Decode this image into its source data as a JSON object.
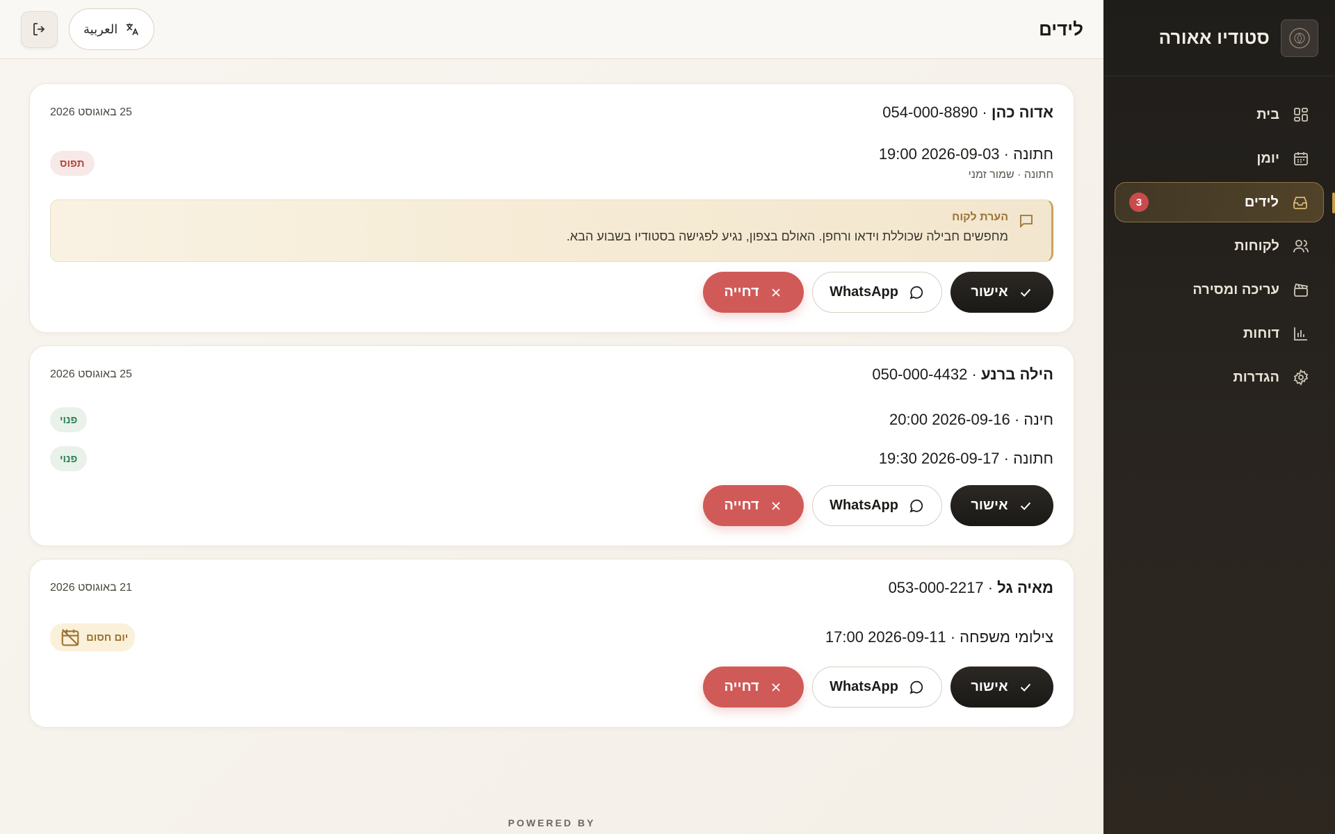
{
  "brand": {
    "name": "סטודיו אאורה"
  },
  "sidebar": {
    "items": [
      {
        "label": "בית",
        "icon": "grid-icon"
      },
      {
        "label": "יומן",
        "icon": "calendar-icon"
      },
      {
        "label": "לידים",
        "icon": "inbox-icon",
        "badge": "3",
        "active": true
      },
      {
        "label": "לקוחות",
        "icon": "users-icon"
      },
      {
        "label": "עריכה ומסירה",
        "icon": "clapperboard-icon"
      },
      {
        "label": "דוחות",
        "icon": "bar-chart-icon"
      },
      {
        "label": "הגדרות",
        "icon": "gear-icon"
      }
    ]
  },
  "header": {
    "title": "לידים",
    "language_label": "العربية"
  },
  "buttons": {
    "approve": "אישור",
    "whatsapp": "WhatsApp",
    "reject": "דחייה"
  },
  "leads": [
    {
      "name": "אדוה כהן",
      "phone": "054-000-8890",
      "date": "25 באוגוסט 2026",
      "slots": [
        {
          "text": "חתונה · 2026-09-03 19:00",
          "sub": "חתונה · שמור זמני",
          "status": "תפוס",
          "kind": "taken"
        }
      ],
      "note": {
        "title": "הערת לקוח",
        "text": "מחפשים חבילה שכוללת וידאו ורחפן. האולם בצפון, נגיע לפגישה בסטודיו בשבוע הבא."
      }
    },
    {
      "name": "הילה ברנע",
      "phone": "050-000-4432",
      "date": "25 באוגוסט 2026",
      "slots": [
        {
          "text": "חינה · 2026-09-16 20:00",
          "status": "פנוי",
          "kind": "free"
        },
        {
          "text": "חתונה · 2026-09-17 19:30",
          "status": "פנוי",
          "kind": "free"
        }
      ]
    },
    {
      "name": "מאיה גל",
      "phone": "053-000-2217",
      "date": "21 באוגוסט 2026",
      "slots": [
        {
          "text": "צילומי משפחה · 2026-09-11 17:00",
          "status": "יום חסום",
          "kind": "blocked"
        }
      ]
    }
  ],
  "footer": {
    "text": "POWERED BY"
  },
  "colors": {
    "accent": "#c99d4b",
    "reject": "#d05a58",
    "dark": "#1f1d1a"
  }
}
